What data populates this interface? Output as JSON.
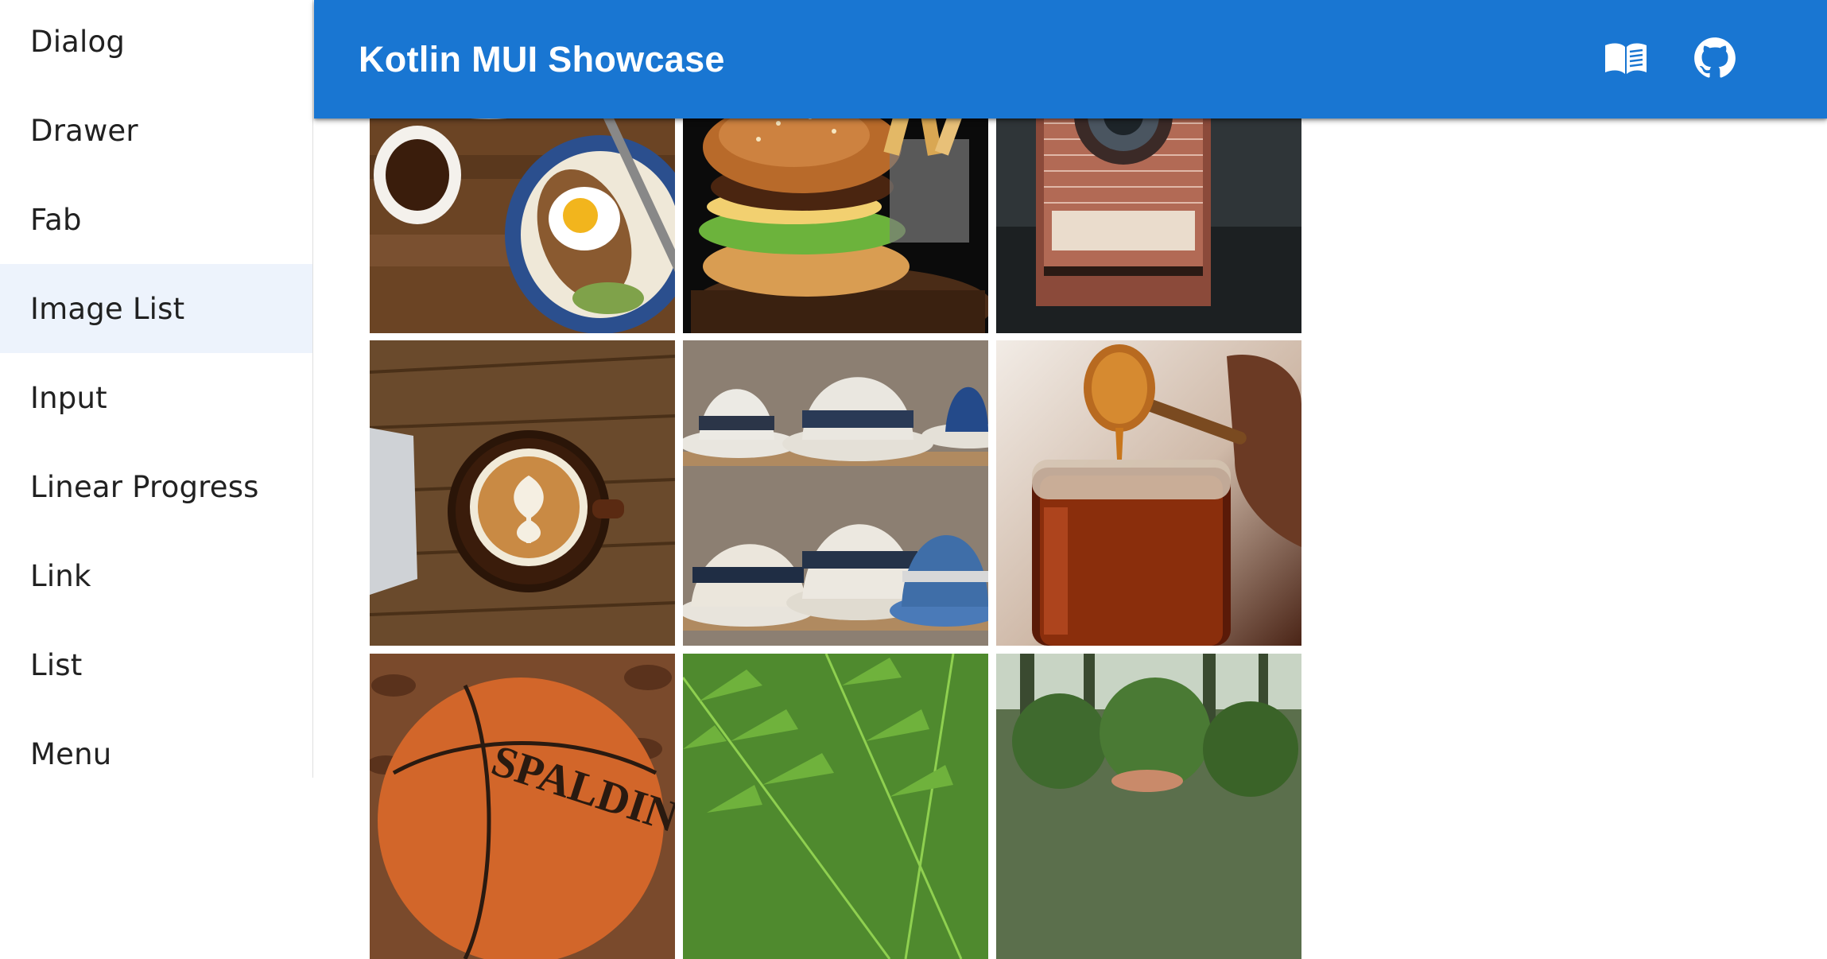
{
  "drawer": {
    "items": [
      {
        "label": "Dialog"
      },
      {
        "label": "Drawer"
      },
      {
        "label": "Fab"
      },
      {
        "label": "Image List",
        "selected": true
      },
      {
        "label": "Input"
      },
      {
        "label": "Linear Progress"
      },
      {
        "label": "Link"
      },
      {
        "label": "List"
      },
      {
        "label": "Menu"
      }
    ]
  },
  "appbar": {
    "title": "Kotlin MUI Showcase",
    "actions": [
      {
        "icon": "book-icon",
        "purpose": "documentation"
      },
      {
        "icon": "github-icon",
        "purpose": "source code"
      }
    ]
  },
  "image_list": {
    "images": [
      {
        "subject": "breakfast"
      },
      {
        "subject": "burger"
      },
      {
        "subject": "camera"
      },
      {
        "subject": "coffee"
      },
      {
        "subject": "hats"
      },
      {
        "subject": "honey"
      },
      {
        "subject": "basketball",
        "text": "SPALDING"
      },
      {
        "subject": "fern"
      },
      {
        "subject": "mushrooms"
      }
    ]
  },
  "colors": {
    "primary": "#1976d2",
    "selected_bg": "#edf3fc",
    "text": "#212121"
  }
}
